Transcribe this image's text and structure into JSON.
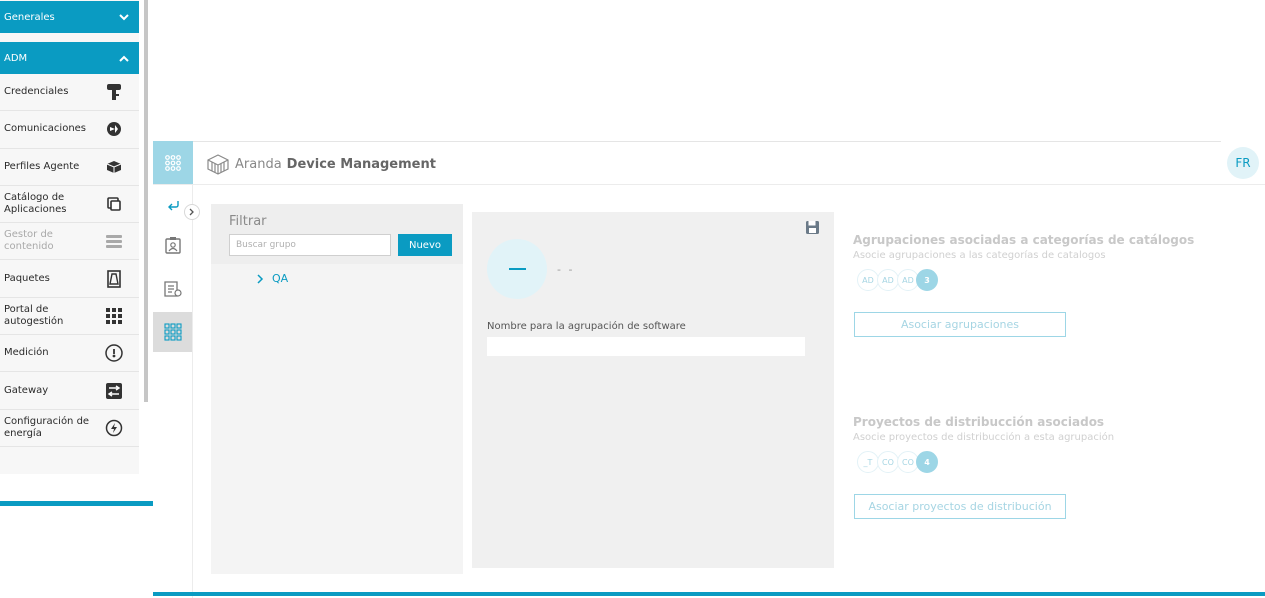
{
  "menu": {
    "general_label": "Generales",
    "adm_label": "ADM",
    "items": [
      {
        "label": "Credenciales",
        "icon": "key-icon"
      },
      {
        "label": "Comunicaciones",
        "icon": "communications-icon"
      },
      {
        "label": "Perfiles Agente",
        "icon": "agent-profile-icon"
      },
      {
        "label": "Catálogo de Aplicaciones",
        "icon": "app-catalog-icon"
      },
      {
        "label": "Gestor de contenido",
        "icon": "content-manager-icon",
        "disabled": true
      },
      {
        "label": "Paquetes",
        "icon": "package-icon"
      },
      {
        "label": "Portal de autogestión",
        "icon": "grid-icon"
      },
      {
        "label": "Medición",
        "icon": "gauge-icon"
      },
      {
        "label": "Gateway",
        "icon": "gateway-icon"
      },
      {
        "label": "Configuración de energía",
        "icon": "energy-icon"
      }
    ]
  },
  "header": {
    "brand_light": "Aranda",
    "brand_bold": "Device Management",
    "avatar_initials": "FR"
  },
  "filter": {
    "title": "Filtrar",
    "search_placeholder": "Buscar grupo",
    "new_button": "Nuevo",
    "tree_node": "QA"
  },
  "detail": {
    "group_name": "- -",
    "name_label": "Nombre para la agrupación de software",
    "name_value": ""
  },
  "catalog_groups": {
    "title": "Agrupaciones asociadas a categorías de catálogos",
    "subtitle": "Asocie agrupaciones a las categorías de catalogos",
    "chips": [
      "AD",
      "AD",
      "AD"
    ],
    "count": "3",
    "button": "Asociar agrupaciones"
  },
  "distribution_projects": {
    "title": "Proyectos de distribucción asociados",
    "subtitle": "Asocie proyectos de distribucción a esta agrupación",
    "chips": [
      "_T",
      "CO",
      "CO"
    ],
    "count": "4",
    "button": "Asociar proyectos de distribución"
  },
  "colors": {
    "accent": "#0a9bc2",
    "accent_light": "#9dd6e6",
    "badge_bg": "#e1f3f8"
  }
}
